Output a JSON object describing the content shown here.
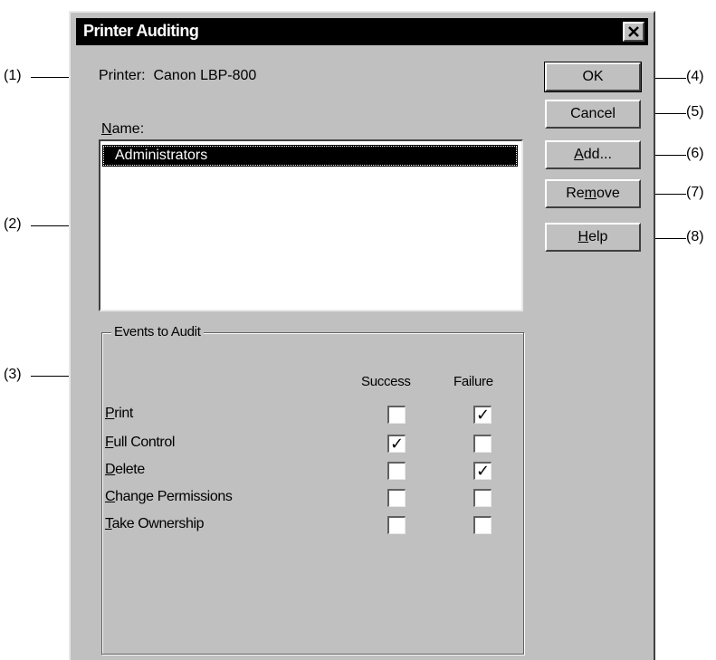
{
  "dialog": {
    "title": "Printer Auditing",
    "close_icon": "close-icon"
  },
  "printer": {
    "label": "Printer:",
    "value": "Canon LBP-800"
  },
  "name_list": {
    "label_accel": "N",
    "label_rest": "ame:",
    "items": [
      "Administrators"
    ],
    "selected_index": 0
  },
  "events": {
    "group_label": "Events to Audit",
    "col_success": "Success",
    "col_failure": "Failure",
    "rows": [
      {
        "accel": "P",
        "rest": "rint",
        "success": false,
        "failure": true
      },
      {
        "accel": "F",
        "rest": "ull Control",
        "success": true,
        "failure": false
      },
      {
        "accel": "D",
        "rest": "elete",
        "success": false,
        "failure": true
      },
      {
        "accel": "C",
        "rest": "hange Permissions",
        "success": false,
        "failure": false
      },
      {
        "accel": "T",
        "rest": "ake Ownership",
        "success": false,
        "failure": false
      }
    ]
  },
  "buttons": {
    "ok": "OK",
    "cancel": "Cancel",
    "add_accel": "A",
    "add_rest": "dd...",
    "remove_pre": "Re",
    "remove_accel": "m",
    "remove_rest": "ove",
    "help_accel": "H",
    "help_rest": "elp"
  },
  "callouts": {
    "c1": "(1)",
    "c2": "(2)",
    "c3": "(3)",
    "c4": "(4)",
    "c5": "(5)",
    "c6": "(6)",
    "c7": "(7)",
    "c8": "(8)"
  },
  "check_glyph": "✓"
}
